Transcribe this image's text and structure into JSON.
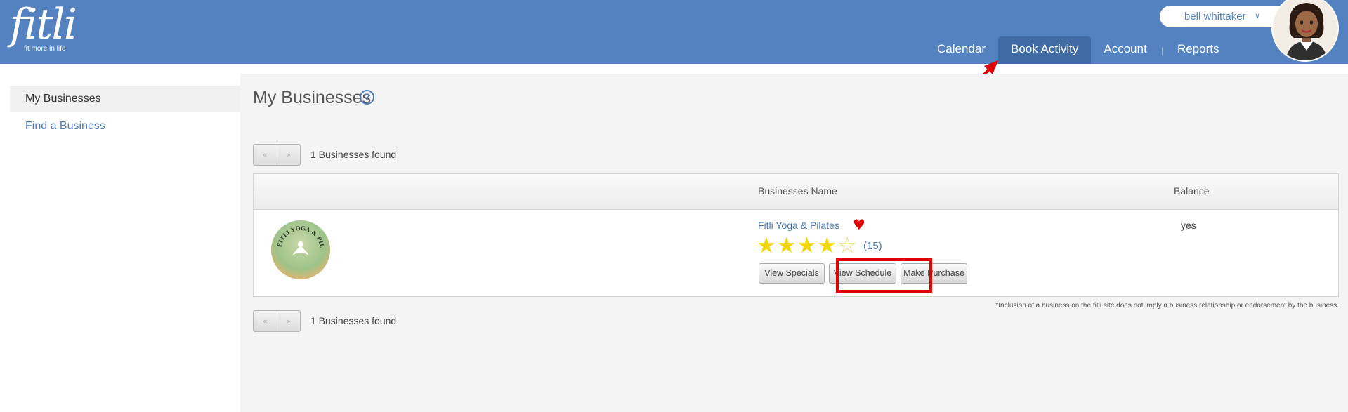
{
  "header": {
    "logo_text": "fitli",
    "logo_tagline": "fit more in life",
    "user_name": "bell whittaker",
    "nav": [
      {
        "label": "Calendar",
        "active": false
      },
      {
        "label": "Book Activity",
        "active": true
      },
      {
        "label": "Account",
        "active": false
      },
      {
        "label": "Reports",
        "active": false
      }
    ],
    "colors": {
      "header_bg": "#5482c1",
      "active_tab": "#3f6aa3",
      "annotation_red": "#e00000"
    }
  },
  "sidebar": {
    "items": [
      {
        "label": "My Businesses",
        "active": true
      },
      {
        "label": "Find a Business",
        "active": false
      }
    ]
  },
  "main": {
    "title": "My Businesses",
    "help_icon": "?",
    "pager_prev": "«",
    "pager_next": "»",
    "found_text": "1 Businesses found",
    "table": {
      "headers": [
        "",
        "Businesses Name",
        "Balance"
      ],
      "rows": [
        {
          "logo_text": "FITLI YOGA & PILATES",
          "name": "Fitli Yoga & Pilates",
          "favorite_icon": "heart-icon",
          "rating": 4,
          "rating_max": 5,
          "review_count": "(15)",
          "balance": "yes",
          "buttons": [
            "View Specials",
            "View Schedule",
            "Make Purchase"
          ]
        }
      ]
    },
    "disclaimer": "*Inclusion of a business on the fitli site does not imply a business relationship or endorsement by the business."
  }
}
